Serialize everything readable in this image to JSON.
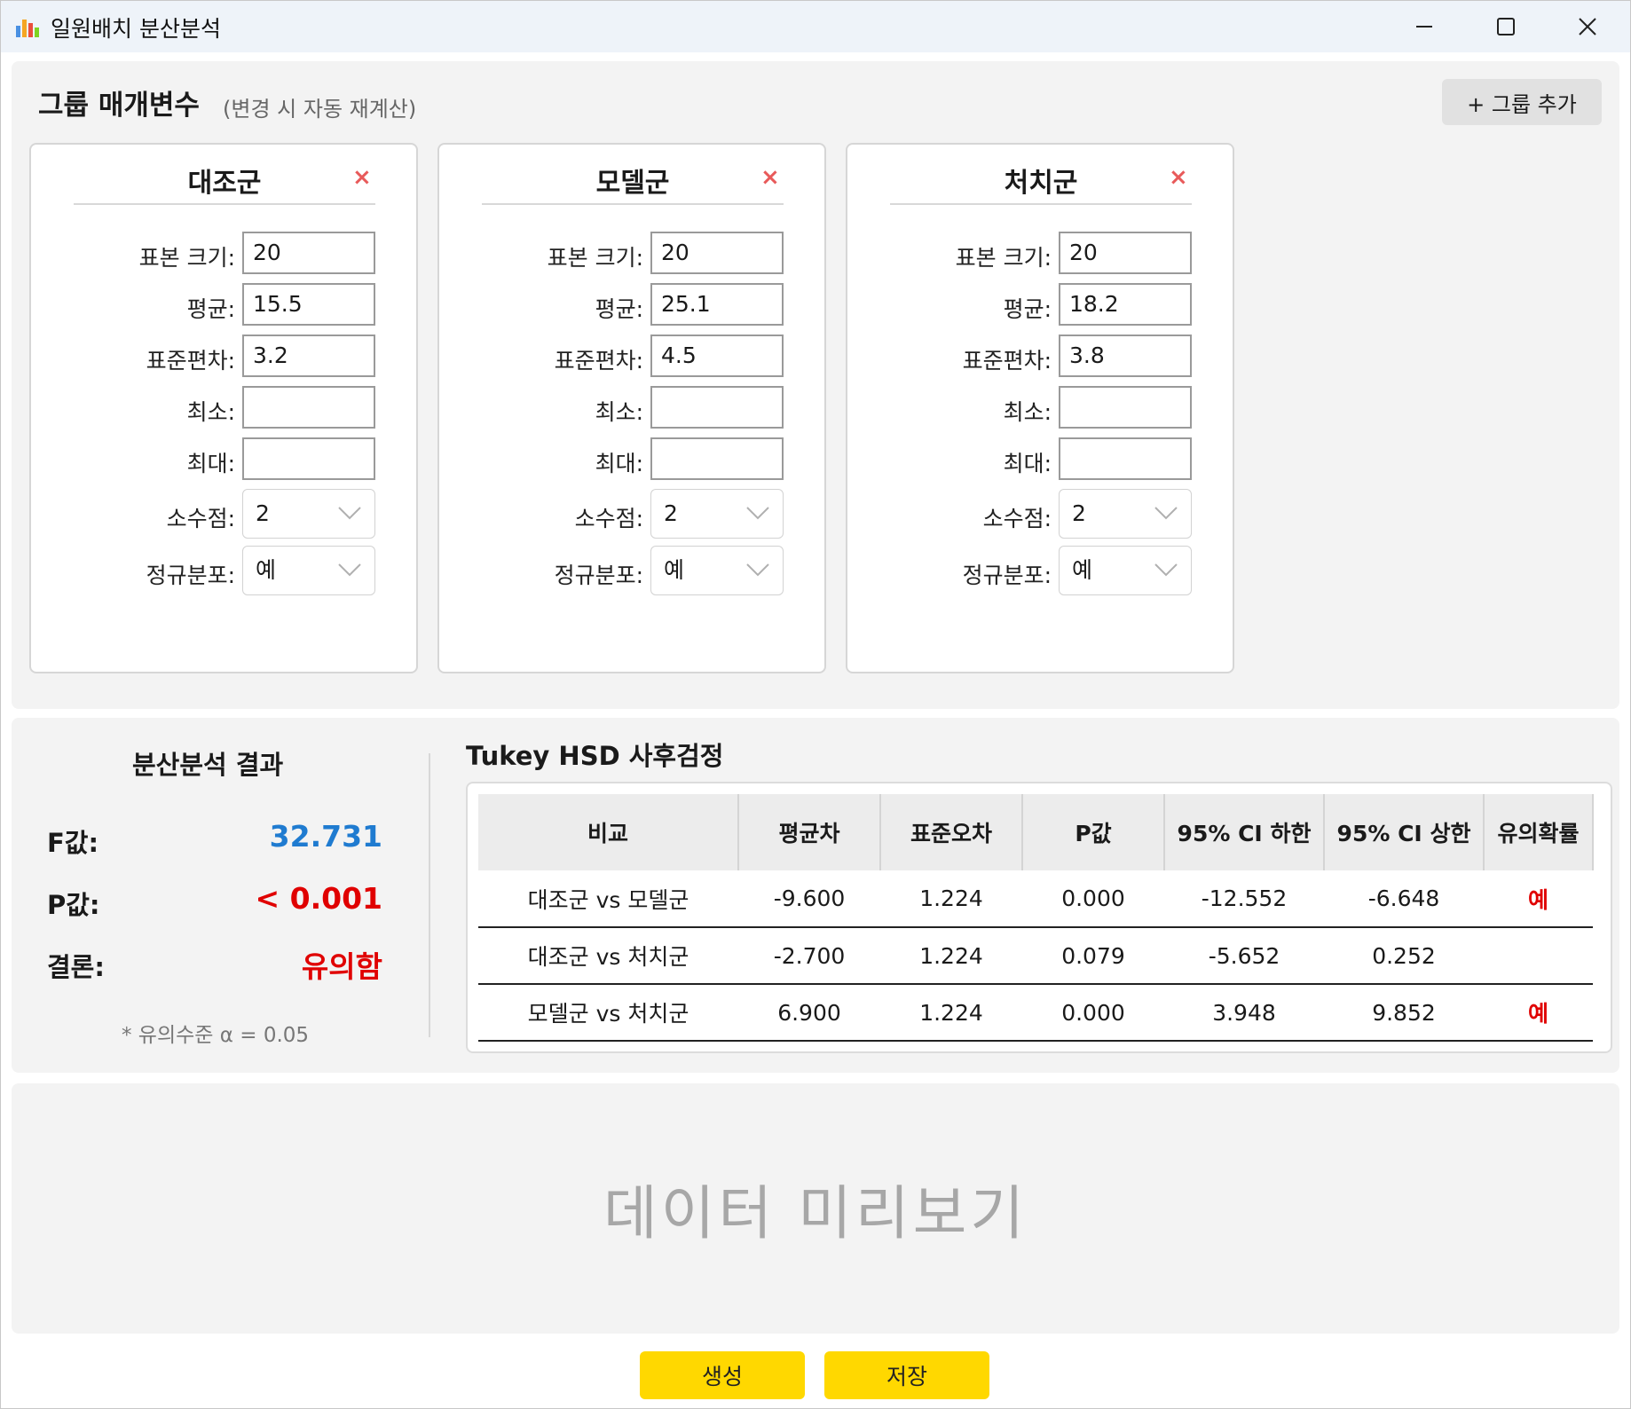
{
  "window": {
    "title": "일원배치 분산분석"
  },
  "params": {
    "title": "그룹 매개변수",
    "subtitle": "(변경 시 자동 재계산)",
    "add_group_label": "+ 그룹 추가",
    "labels": {
      "sample_size": "표본 크기:",
      "mean": "평균:",
      "std": "표준편차:",
      "min": "최소:",
      "max": "최대:",
      "decimals": "소수점:",
      "normal": "정규분포:"
    },
    "close_symbol": "×",
    "groups": [
      {
        "name": "대조군",
        "sample_size": "20",
        "mean": "15.5",
        "std": "3.2",
        "min": "",
        "max": "",
        "decimals": "2",
        "normal": "예"
      },
      {
        "name": "모델군",
        "sample_size": "20",
        "mean": "25.1",
        "std": "4.5",
        "min": "",
        "max": "",
        "decimals": "2",
        "normal": "예"
      },
      {
        "name": "처치군",
        "sample_size": "20",
        "mean": "18.2",
        "std": "3.8",
        "min": "",
        "max": "",
        "decimals": "2",
        "normal": "예"
      }
    ]
  },
  "results": {
    "title": "분산분석 결과",
    "f_label": "F값:",
    "f_value": "32.731",
    "p_label": "P값:",
    "p_value": "< 0.001",
    "conclusion_label": "결론:",
    "conclusion_value": "유의함",
    "note": "* 유의수준 α = 0.05",
    "colors": {
      "f_value": "#1f7bd0",
      "significant": "#e00000"
    }
  },
  "tukey": {
    "title": "Tukey HSD 사후검정",
    "columns": [
      "비교",
      "평균차",
      "표준오차",
      "P값",
      "95% CI 하한",
      "95% CI 상한",
      "유의확률"
    ],
    "rows": [
      [
        "대조군 vs 모델군",
        "-9.600",
        "1.224",
        "0.000",
        "-12.552",
        "-6.648",
        "예"
      ],
      [
        "대조군 vs 처치군",
        "-2.700",
        "1.224",
        "0.079",
        "-5.652",
        "0.252",
        ""
      ],
      [
        "모델군 vs 처치군",
        "6.900",
        "1.224",
        "0.000",
        "3.948",
        "9.852",
        "예"
      ]
    ]
  },
  "preview": {
    "placeholder": "데이터 미리보기"
  },
  "actions": {
    "generate_label": "생성",
    "save_label": "저장",
    "accent": "#ffd800"
  }
}
